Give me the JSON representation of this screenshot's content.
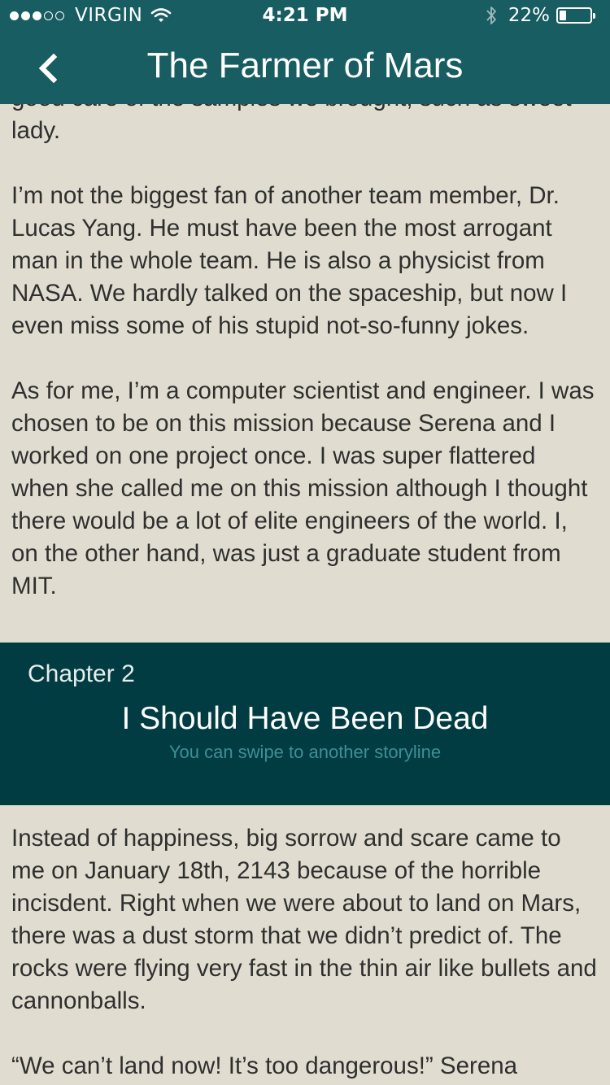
{
  "status_bar": {
    "carrier": "VIRGIN",
    "time": "4:21 PM",
    "battery_percent": "22%",
    "battery_level": 0.22,
    "signal_bars_filled": 3,
    "signal_bars_total": 5
  },
  "nav": {
    "title": "The Farmer of Mars"
  },
  "story_top": {
    "paragraphs": [
      "good care of the samples we brought, such as sweet lady.",
      "I’m not the biggest fan of another team member, Dr. Lucas Yang. He must have been the most arrogant man in the whole team. He is also a physicist from NASA. We hardly talked on the spaceship, but now I even miss some of his stupid not-so-funny jokes.",
      "As for me, I’m a computer scientist and engineer. I was chosen to be on this mission because Serena and I worked on one project once. I was super flattered when she called me on this mission although I thought there would be a lot of elite engineers of the world. I, on the other hand, was just a graduate student from MIT."
    ]
  },
  "chapter": {
    "label": "Chapter 2",
    "title": "I Should Have Been Dead",
    "hint": "You can swipe to another storyline"
  },
  "story_bottom": {
    "paragraphs": [
      "Instead of happiness, big sorrow and scare came to me on January 18th, 2143 because of the horrible incisdent. Right when we were about to land on Mars, there was a dust storm that we didn’t predict of. The rocks were flying very fast in the thin air like bullets and cannonballs.",
      "“We can’t land now! It’s too dangerous!” Serena"
    ]
  },
  "colors": {
    "header": "#175d62",
    "page": "#e0ddd0",
    "chapter_banner": "#003c41",
    "hint_text": "#3f8e96"
  },
  "icons": {
    "back": "chevron-left-icon",
    "wifi": "wifi-icon",
    "bluetooth": "bluetooth-icon",
    "battery": "battery-icon"
  }
}
